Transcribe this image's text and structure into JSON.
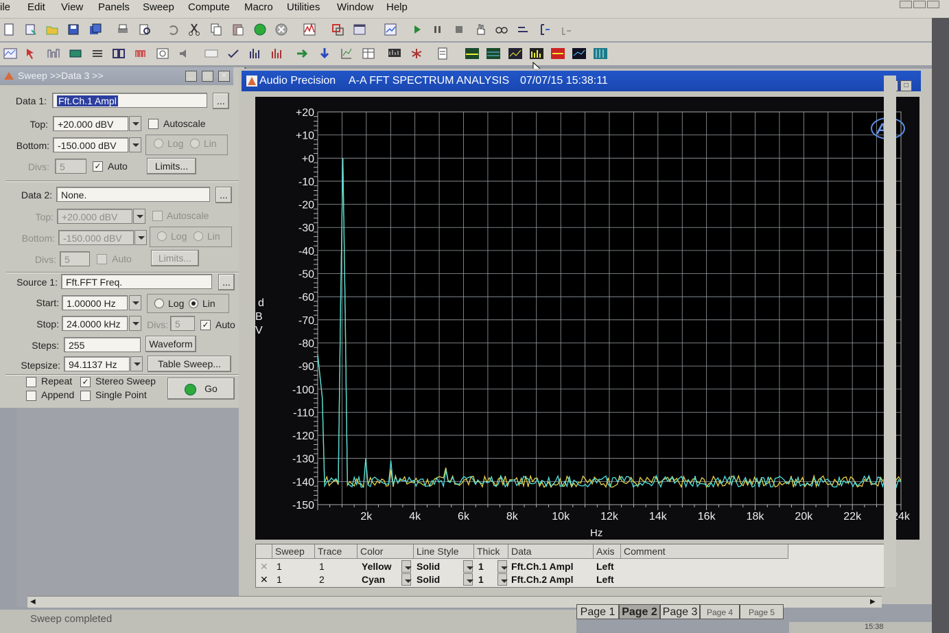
{
  "menu": [
    "ile",
    "Edit",
    "View",
    "Panels",
    "Sweep",
    "Compute",
    "Macro",
    "Utilities",
    "Window",
    "Help"
  ],
  "sweep_panel": {
    "title": "Sweep >>Data 3 >>",
    "data1": {
      "label": "Data 1:",
      "value": "Fft.Ch.1 Ampl",
      "top_label": "Top:",
      "top": "+20.000  dBV",
      "autoscale": "Autoscale",
      "bottom_label": "Bottom:",
      "bottom": "-150.000 dBV",
      "log": "Log",
      "lin": "Lin",
      "divs_label": "Divs:",
      "divs": "5",
      "auto": "Auto",
      "limits": "Limits..."
    },
    "data2": {
      "label": "Data 2:",
      "value": "None.",
      "top_label": "Top:",
      "top": "+20.000  dBV",
      "autoscale": "Autoscale",
      "bottom_label": "Bottom:",
      "bottom": "-150.000 dBV",
      "log": "Log",
      "lin": "Lin",
      "divs_label": "Divs:",
      "divs": "5",
      "auto": "Auto",
      "limits": "Limits..."
    },
    "source1": {
      "label": "Source 1:",
      "value": "Fft.FFT Freq.",
      "start_label": "Start:",
      "start": "1.00000  Hz",
      "log": "Log",
      "lin": "Lin",
      "stop_label": "Stop:",
      "stop": "24.0000 kHz",
      "divs_label": "Divs:",
      "divs": "5",
      "auto": "Auto",
      "steps_label": "Steps:",
      "steps": "255",
      "waveform": "Waveform",
      "stepsize_label": "Stepsize:",
      "stepsize": "94.1137  Hz",
      "table_sweep": "Table Sweep..."
    },
    "options": {
      "repeat": "Repeat",
      "stereo": "Stereo Sweep",
      "append": "Append",
      "single": "Single Point",
      "go": "Go"
    }
  },
  "graph": {
    "title_left": "Audio Precision",
    "title_mid": "A-A FFT SPECTRUM ANALYSIS",
    "title_date": "07/07/15 15:38:11",
    "logo": "Ap",
    "ylabel": [
      "d",
      "B",
      "V"
    ],
    "xlabel": "Hz"
  },
  "chart_data": {
    "type": "line",
    "title": "A-A FFT SPECTRUM ANALYSIS",
    "xlabel": "Hz",
    "ylabel": "dBV",
    "xlim": [
      0,
      24000
    ],
    "ylim": [
      -150,
      20
    ],
    "x_tick_labels": [
      "2k",
      "4k",
      "6k",
      "8k",
      "10k",
      "12k",
      "14k",
      "16k",
      "18k",
      "20k",
      "22k",
      "24k"
    ],
    "x_ticks": [
      2000,
      4000,
      6000,
      8000,
      10000,
      12000,
      14000,
      16000,
      18000,
      20000,
      22000,
      24000
    ],
    "y_tick_labels": [
      "+20",
      "+10",
      "+0",
      "-10",
      "-20",
      "-30",
      "-40",
      "-50",
      "-60",
      "-70",
      "-80",
      "-90",
      "-100",
      "-110",
      "-120",
      "-130",
      "-140",
      "-150"
    ],
    "y_ticks": [
      20,
      10,
      0,
      -10,
      -20,
      -30,
      -40,
      -50,
      -60,
      -70,
      -80,
      -90,
      -100,
      -110,
      -120,
      -130,
      -140,
      -150
    ],
    "grid": true,
    "series": [
      {
        "color": "#e6d24a",
        "peaks": [
          [
            1000,
            0
          ],
          [
            2000,
            -130
          ],
          [
            3000,
            -135
          ],
          [
            5300,
            -134
          ]
        ],
        "floor": -140
      },
      {
        "color": "#52e0e0",
        "peaks": [
          [
            1000,
            0
          ],
          [
            2000,
            -130
          ],
          [
            3000,
            -131
          ],
          [
            5300,
            -135
          ]
        ],
        "floor": -140
      }
    ]
  },
  "trace_table": {
    "headers": [
      "Sweep",
      "Trace",
      "Color",
      "Line Style",
      "Thick",
      "Data",
      "Axis",
      "Comment"
    ],
    "rows": [
      {
        "sweep": "1",
        "trace": "1",
        "color": "Yellow",
        "style": "Solid",
        "thick": "1",
        "data": "Fft.Ch.1 Ampl",
        "axis": "Left"
      },
      {
        "sweep": "1",
        "trace": "2",
        "color": "Cyan",
        "style": "Solid",
        "thick": "1",
        "data": "Fft.Ch.2 Ampl",
        "axis": "Left"
      }
    ]
  },
  "pages": [
    "Page 1",
    "Page 2",
    "Page 3",
    "Page 4",
    "Page 5"
  ],
  "status": "Sweep completed",
  "clock": "15:38"
}
